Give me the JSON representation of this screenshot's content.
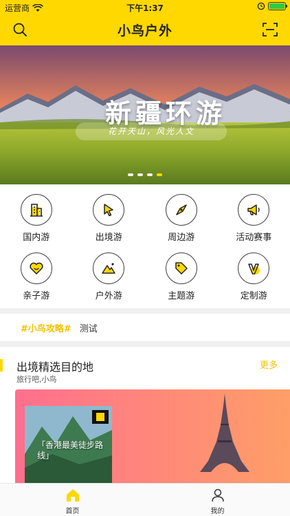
{
  "status_bar": {
    "carrier": "运营商",
    "time": "下午1:37"
  },
  "nav": {
    "title": "小鸟户外",
    "left_icon": "search-icon",
    "right_icon": "scan-icon"
  },
  "banner": {
    "title": "新疆环游",
    "subtitle": "花开天山，风光人文",
    "page_count": 4,
    "active_index": 3
  },
  "categories": [
    {
      "label": "国内游",
      "icon": "building-icon"
    },
    {
      "label": "出境游",
      "icon": "cursor-icon"
    },
    {
      "label": "周边游",
      "icon": "compass-icon"
    },
    {
      "label": "活动赛事",
      "icon": "megaphone-icon"
    },
    {
      "label": "亲子游",
      "icon": "heart-icon"
    },
    {
      "label": "户外游",
      "icon": "mountain-icon"
    },
    {
      "label": "主题游",
      "icon": "tag-icon"
    },
    {
      "label": "定制游",
      "icon": "v-icon"
    }
  ],
  "topic": {
    "tag": "#小鸟攻略#",
    "text": "测试"
  },
  "section": {
    "title": "出境精选目的地",
    "subtitle": "旅行吧,小鸟",
    "more": "更多"
  },
  "feature": {
    "caption": "「香港最美徒步路线」"
  },
  "tabbar": {
    "items": [
      {
        "label": "首页",
        "icon": "home-icon",
        "active": true
      },
      {
        "label": "我的",
        "icon": "user-icon",
        "active": false
      }
    ]
  },
  "colors": {
    "brand_yellow": "#FFD800",
    "accent_text": "#F3C300"
  }
}
